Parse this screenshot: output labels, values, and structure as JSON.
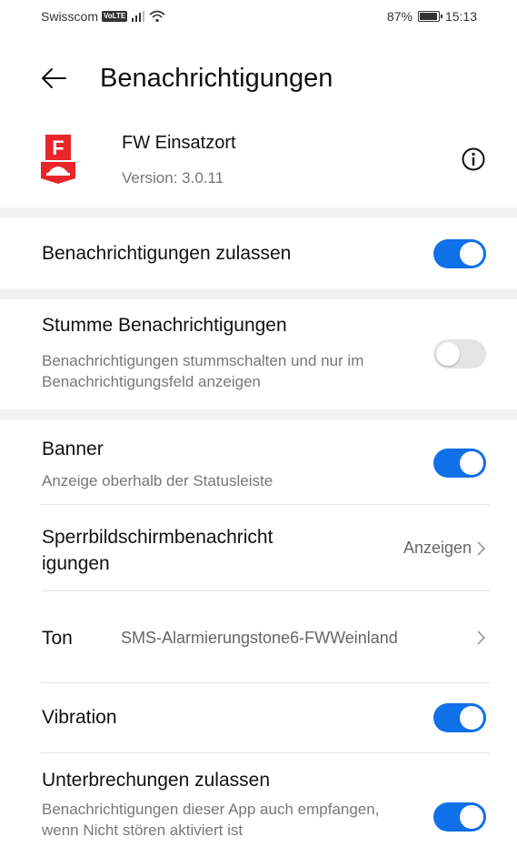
{
  "status_bar": {
    "carrier": "Swisscom",
    "volte": "VoLTE",
    "battery": "87%",
    "battery_level": 0.87,
    "time": "15:13"
  },
  "header": {
    "title": "Benachrichtigungen"
  },
  "app": {
    "name": "FW Einsatzort",
    "version": "Version: 3.0.11",
    "icon_letter": "F"
  },
  "settings": {
    "allow": {
      "title": "Benachrichtigungen zulassen",
      "enabled": true
    },
    "silent": {
      "title": "Stumme Benachrichtigungen",
      "subtitle": "Benachrichtigungen stummschalten und nur im Benachrichtigungsfeld anzeigen",
      "enabled": false
    },
    "banner": {
      "title": "Banner",
      "subtitle": "Anzeige oberhalb der Statusleiste",
      "enabled": true
    },
    "lockscreen": {
      "title": "Sperrbildschirmbenachricht igungen",
      "value": "Anzeigen"
    },
    "sound": {
      "title": "Ton",
      "value": "SMS-Alarmierungstone6-FWWeinland"
    },
    "vibration": {
      "title": "Vibration",
      "enabled": true
    },
    "interruptions": {
      "title": "Unterbrechungen zulassen",
      "subtitle": "Benachrichtigungen dieser App auch empfangen, wenn Nicht stören aktiviert ist",
      "enabled": true
    }
  },
  "colors": {
    "accent": "#1070e8",
    "toggle_off": "#e4e4e4",
    "app_icon": "#e8252a"
  }
}
